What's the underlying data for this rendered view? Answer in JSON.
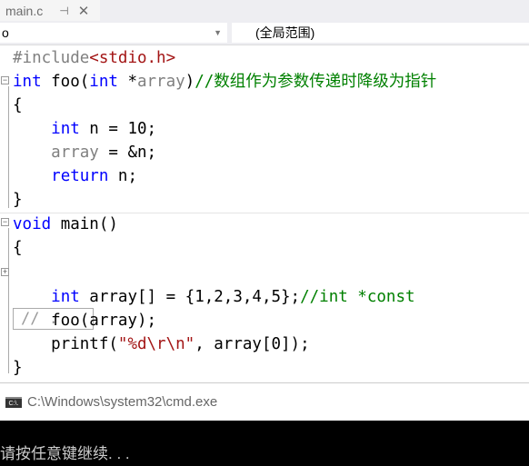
{
  "tab": {
    "title": "main.c",
    "pin_icon": "pin-icon",
    "close_icon": "close-icon"
  },
  "nav": {
    "scope_left": "o",
    "scope_right": "(全局范围)"
  },
  "code": {
    "lines": [
      [
        {
          "t": "#include",
          "c": "pp"
        },
        {
          "t": "<stdio.h>",
          "c": "str"
        }
      ],
      [
        {
          "t": "int",
          "c": "kw"
        },
        {
          "t": " foo(",
          "c": "id"
        },
        {
          "t": "int",
          "c": "kw"
        },
        {
          "t": " *",
          "c": "id"
        },
        {
          "t": "array",
          "c": "par"
        },
        {
          "t": ")",
          "c": "id"
        },
        {
          "t": "//数组作为参数传递时降级为指针",
          "c": "cm"
        }
      ],
      [
        {
          "t": "{",
          "c": "id"
        }
      ],
      [
        {
          "t": "    ",
          "c": "id"
        },
        {
          "t": "int",
          "c": "kw"
        },
        {
          "t": " n = 10;",
          "c": "id"
        }
      ],
      [
        {
          "t": "    ",
          "c": "id"
        },
        {
          "t": "array",
          "c": "par"
        },
        {
          "t": " = &n;",
          "c": "id"
        }
      ],
      [
        {
          "t": "    ",
          "c": "id"
        },
        {
          "t": "return",
          "c": "kw"
        },
        {
          "t": " n;",
          "c": "id"
        }
      ],
      [
        {
          "t": "}",
          "c": "id"
        }
      ],
      [
        {
          "t": "void",
          "c": "kw"
        },
        {
          "t": " main()",
          "c": "id"
        }
      ],
      [
        {
          "t": "{",
          "c": "id"
        }
      ],
      [],
      [
        {
          "t": "    ",
          "c": "id"
        },
        {
          "t": "int",
          "c": "kw"
        },
        {
          "t": " array[] = {1,2,3,4,5};",
          "c": "id"
        },
        {
          "t": "//int *const",
          "c": "cm"
        }
      ],
      [
        {
          "t": "    foo(array);",
          "c": "id"
        }
      ],
      [
        {
          "t": "    printf(",
          "c": "id"
        },
        {
          "t": "\"%d\\r\\n\"",
          "c": "str"
        },
        {
          "t": ", array[0]);",
          "c": "id"
        }
      ],
      [
        {
          "t": "}",
          "c": "id"
        }
      ]
    ],
    "collapsed": "// ..."
  },
  "console": {
    "title": "C:\\Windows\\system32\\cmd.exe",
    "icon_text": "C:\\.",
    "output": "请按任意键继续. . ."
  }
}
